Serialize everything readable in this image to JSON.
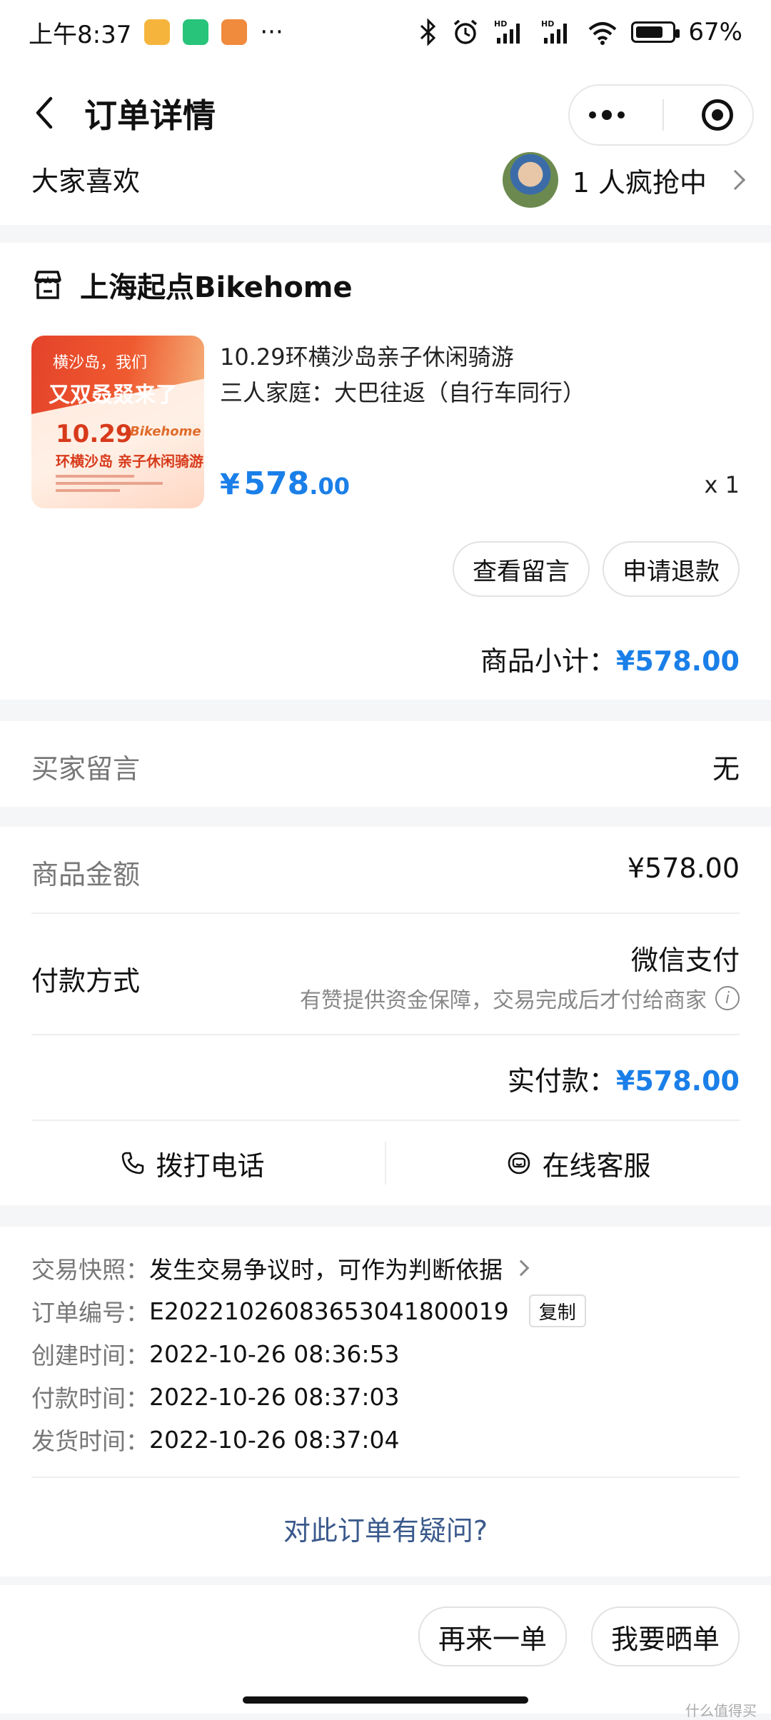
{
  "status_bar": {
    "time": "上午8:37",
    "more": "···",
    "battery": "67%",
    "battery_level": 0.67
  },
  "header": {
    "title": "订单详情"
  },
  "group": {
    "label": "大家喜欢",
    "buyers_text": "1 人疯抢中"
  },
  "shop": {
    "name": "上海起点Bikehome",
    "product": {
      "image_text": {
        "line1": "横沙岛，我们",
        "line2": "又双叒叕来了",
        "date": "10.29",
        "brand": "Bikehome",
        "subtitle": "环横沙岛 亲子休闲骑游"
      },
      "title": "10.29环横沙岛亲子休闲骑游",
      "spec": "三人家庭：大巴往返（自行车同行）",
      "price_symbol": "¥",
      "price_int": "578",
      "price_dec": ".00",
      "qty": "x 1"
    },
    "buttons": {
      "view_note": "查看留言",
      "refund": "申请退款"
    },
    "subtotal_label": "商品小计：",
    "subtotal_value": "¥578.00"
  },
  "buyer_note": {
    "label": "买家留言",
    "value": "无"
  },
  "payment": {
    "amount_label": "商品金额",
    "amount_value": "¥578.00",
    "method_label": "付款方式",
    "method_value": "微信支付",
    "guarantee": "有赞提供资金保障，交易完成后才付给商家",
    "actual_label": "实付款：",
    "actual_value": "¥578.00",
    "call": "拨打电话",
    "service": "在线客服"
  },
  "info": {
    "snapshot_key": "交易快照：",
    "snapshot_val": "发生交易争议时，可作为判断依据",
    "order_no_key": "订单编号：",
    "order_no_val": "E20221026083653041800019",
    "copy": "复制",
    "created_key": "创建时间：",
    "created_val": "2022-10-26 08:36:53",
    "paid_key": "付款时间：",
    "paid_val": "2022-10-26 08:37:03",
    "shipped_key": "发货时间：",
    "shipped_val": "2022-10-26 08:37:04",
    "question": "对此订单有疑问?"
  },
  "bottom": {
    "reorder": "再来一单",
    "share": "我要晒单"
  },
  "watermark": "什么值得买",
  "colors": {
    "accent": "#1a7fe8",
    "link": "#3b5a8c",
    "background": "#f5f6f7"
  }
}
